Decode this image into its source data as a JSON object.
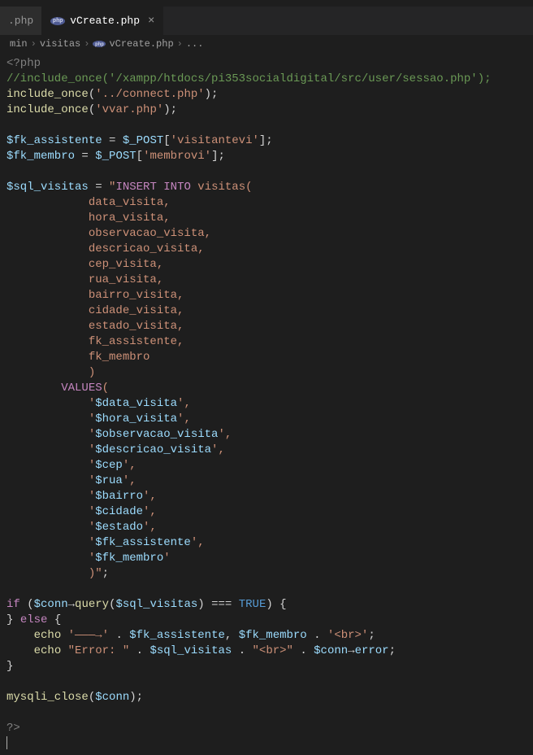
{
  "tabs": {
    "inactive": {
      "label": ".php"
    },
    "active": {
      "label": "vCreate.php"
    }
  },
  "breadcrumb": {
    "p1": "min",
    "p2": "visitas",
    "p3": "vCreate.php",
    "p4": "..."
  },
  "code": {
    "l1_open": "<?php",
    "l2_c1": "//include_once('/xampp/htdocs/pi353socialdigital/src/user/sessao.php');",
    "l3_fn": "include_once",
    "l3_par_o": "(",
    "l3_str": "'../connect.php'",
    "l3_par_c": ");",
    "l4_fn": "include_once",
    "l4_par_o": "(",
    "l4_str": "'vvar.php'",
    "l4_par_c": ");",
    "l6_var": "$fk_assistente",
    "l6_eq": " = ",
    "l6_post": "$_POST",
    "l6_br_o": "[",
    "l6_str": "'visitantevi'",
    "l6_br_c": "];",
    "l7_var": "$fk_membro",
    "l7_eq": " = ",
    "l7_post": "$_POST",
    "l7_br_o": "[",
    "l7_str": "'membrovi'",
    "l7_br_c": "];",
    "l9_var": "$sql_visitas",
    "l9_eq": " = ",
    "l9_q": "\"",
    "l9_ins": "INSERT",
    "l9_sp1": " ",
    "l9_into": "INTO",
    "l9_rest": " visitas(",
    "l10": "            data_visita,",
    "l11": "            hora_visita,",
    "l12": "            observacao_visita,",
    "l13": "            descricao_visita,",
    "l14": "            cep_visita,",
    "l15": "            rua_visita,",
    "l16": "            bairro_visita,",
    "l17": "            cidade_visita,",
    "l18": "            estado_visita,",
    "l19": "            fk_assistente,",
    "l20": "            fk_membro",
    "l21": "            )",
    "l22_ind": "        ",
    "l22_val": "VALUES",
    "l22_par": "(",
    "l23_a": "            '",
    "l23_v": "$data_visita",
    "l23_b": "',",
    "l24_a": "            '",
    "l24_v": "$hora_visita",
    "l24_b": "',",
    "l25_a": "            '",
    "l25_v": "$observacao_visita",
    "l25_b": "',",
    "l26_a": "            '",
    "l26_v": "$descricao_visita",
    "l26_b": "',",
    "l27_a": "            '",
    "l27_v": "$cep",
    "l27_b": "',",
    "l28_a": "            '",
    "l28_v": "$rua",
    "l28_b": "',",
    "l29_a": "            '",
    "l29_v": "$bairro",
    "l29_b": "',",
    "l30_a": "            '",
    "l30_v": "$cidade",
    "l30_b": "',",
    "l31_a": "            '",
    "l31_v": "$estado",
    "l31_b": "',",
    "l32_a": "            '",
    "l32_v": "$fk_assistente",
    "l32_b": "',",
    "l33_a": "            '",
    "l33_v": "$fk_membro",
    "l33_b": "'",
    "l34_a": "            )",
    "l34_q": "\"",
    "l34_s": ";",
    "l36_if": "if",
    "l36_sp": " (",
    "l36_conn": "$conn",
    "l36_arr": "→",
    "l36_query": "query",
    "l36_po": "(",
    "l36_sv": "$sql_visitas",
    "l36_pc": ") ",
    "l36_eqeq": "===",
    "l36_sp2": " ",
    "l36_true": "TRUE",
    "l36_end": ") {",
    "l37_brace": "}",
    "l37_sp": " ",
    "l37_else": "else",
    "l37_ob": " {",
    "l38_ind": "    ",
    "l38_echo": "echo",
    "l38_s1": " '———→' ",
    "l38_dot1": ".",
    "l38_sp1": " ",
    "l38_v1": "$fk_assistente",
    "l38_com": ", ",
    "l38_v2": "$fk_membro",
    "l38_sp2": " ",
    "l38_dot2": ".",
    "l38_sp3": " ",
    "l38_br": "'<br>'",
    "l38_sc": ";",
    "l39_ind": "    ",
    "l39_echo": "echo",
    "l39_sp0": " ",
    "l39_s1": "\"Error: \"",
    "l39_sp1": " ",
    "l39_d1": ".",
    "l39_sp2": " ",
    "l39_v1": "$sql_visitas",
    "l39_sp3": " ",
    "l39_d2": ".",
    "l39_sp4": " ",
    "l39_s2": "\"<br>\"",
    "l39_sp5": " ",
    "l39_d3": ".",
    "l39_sp6": " ",
    "l39_conn": "$conn",
    "l39_arr": "→",
    "l39_err": "error",
    "l39_sc": ";",
    "l40": "}",
    "l42_fn": "mysqli_close",
    "l42_po": "(",
    "l42_v": "$conn",
    "l42_pc": ");",
    "l44": "?>"
  }
}
